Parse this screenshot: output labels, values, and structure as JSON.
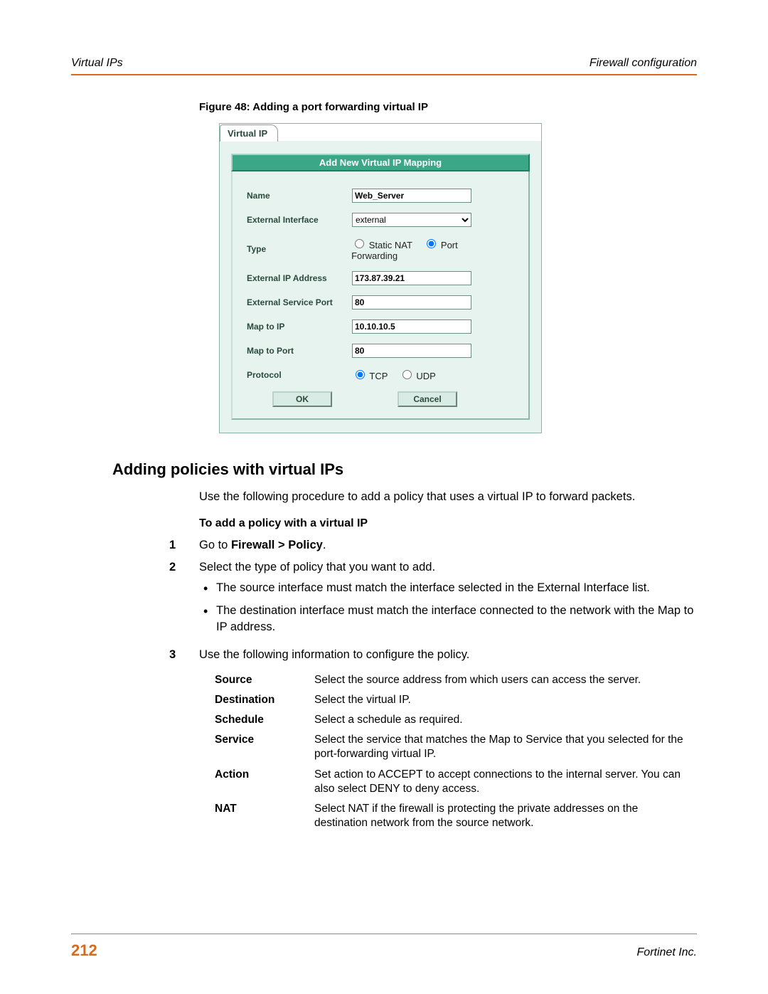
{
  "header": {
    "left": "Virtual IPs",
    "right": "Firewall configuration"
  },
  "figure_caption": "Figure 48: Adding a port forwarding virtual IP",
  "screenshot": {
    "tab": "Virtual IP",
    "panel_title": "Add New Virtual IP Mapping",
    "labels": {
      "name": "Name",
      "external_interface": "External Interface",
      "type": "Type",
      "external_ip": "External IP Address",
      "external_port": "External Service Port",
      "map_ip": "Map to IP",
      "map_port": "Map to Port",
      "protocol": "Protocol"
    },
    "values": {
      "name": "Web_Server",
      "external_interface": "external",
      "external_ip": "173.87.39.21",
      "external_port": "80",
      "map_ip": "10.10.10.5",
      "map_port": "80"
    },
    "type_options": {
      "static_nat": "Static NAT",
      "port_forwarding": "Port Forwarding"
    },
    "protocol_options": {
      "tcp": "TCP",
      "udp": "UDP"
    },
    "buttons": {
      "ok": "OK",
      "cancel": "Cancel"
    }
  },
  "section_heading": "Adding policies with virtual IPs",
  "intro_text": "Use the following procedure to add a policy that uses a virtual IP to forward packets.",
  "subheading": "To add a policy with a virtual IP",
  "steps": {
    "s1_prefix": "Go to ",
    "s1_bold": "Firewall > Policy",
    "s1_suffix": ".",
    "s2": "Select the type of policy that you want to add.",
    "s2_b1": "The source interface must match the interface selected in the External Interface list.",
    "s2_b2": "The destination interface must match the interface connected to the network with the Map to IP address.",
    "s3": "Use the following information to configure the policy."
  },
  "config_table": [
    {
      "key": "Source",
      "val": "Select the source address from which users can access the server."
    },
    {
      "key": "Destination",
      "val": "Select the virtual IP."
    },
    {
      "key": "Schedule",
      "val": "Select a schedule as required."
    },
    {
      "key": "Service",
      "val": "Select the service that matches the Map to Service that you selected for the port-forwarding virtual IP."
    },
    {
      "key": "Action",
      "val": "Set action to ACCEPT to accept connections to the internal server. You can also select DENY to deny access."
    },
    {
      "key": "NAT",
      "val": "Select NAT if the firewall is protecting the private addresses on the destination network from the source network."
    }
  ],
  "footer": {
    "page": "212",
    "company": "Fortinet Inc."
  }
}
